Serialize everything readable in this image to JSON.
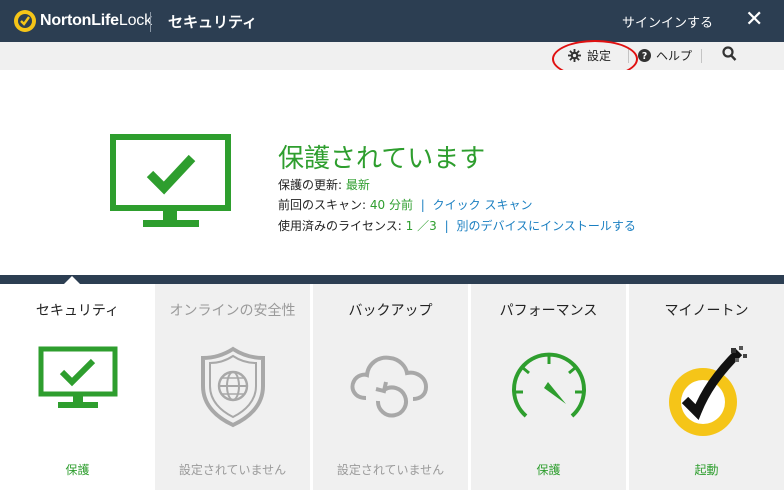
{
  "header": {
    "brand_primary": "NortonLife",
    "brand_secondary": "Lock",
    "app_title": "セキュリティ",
    "signin_label": "サインインする",
    "close_symbol": "✕"
  },
  "toolbar": {
    "settings_label": "設定",
    "help_label": "ヘルプ"
  },
  "status": {
    "title": "保護されています",
    "update_label": "保護の更新:",
    "update_value": "最新",
    "scan_label": "前回のスキャン:",
    "scan_value": "40 分前",
    "scan_link": "クイック スキャン",
    "license_label": "使用済みのライセンス:",
    "license_value": "1 ／3",
    "license_link": "別のデバイスにインストールする",
    "separator": "|"
  },
  "tiles": [
    {
      "title": "セキュリティ",
      "status": "保護",
      "icon": "monitor-check-icon"
    },
    {
      "title": "オンラインの安全性",
      "status": "設定されていません",
      "icon": "shield-globe-icon"
    },
    {
      "title": "バックアップ",
      "status": "設定されていません",
      "icon": "cloud-backup-icon"
    },
    {
      "title": "パフォーマンス",
      "status": "保護",
      "icon": "speedometer-icon"
    },
    {
      "title": "マイノートン",
      "status": "起動",
      "icon": "norton-check-icon"
    }
  ],
  "colors": {
    "header_bg": "#2c3e52",
    "protected_green": "#2e9e2e",
    "link_blue": "#1a7fc1",
    "highlight_red": "#e01010",
    "norton_yellow": "#f5c518"
  }
}
